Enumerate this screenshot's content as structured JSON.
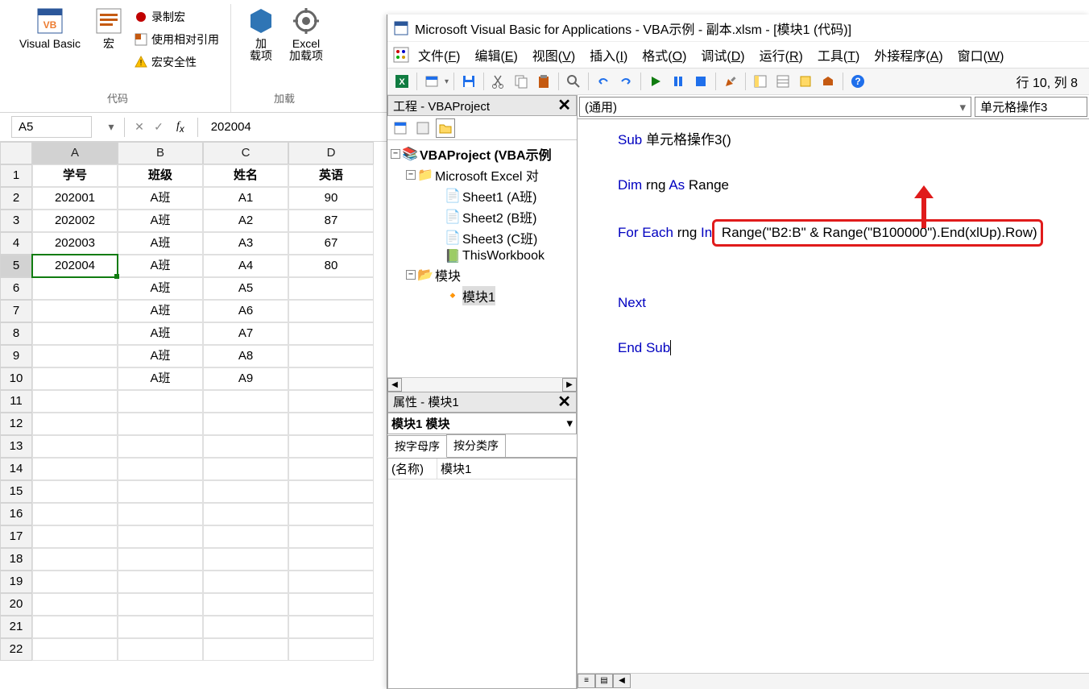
{
  "ribbon": {
    "vb_label": "Visual Basic",
    "macro_label": "宏",
    "record_macro": "录制宏",
    "use_relative": "使用相对引用",
    "macro_security": "宏安全性",
    "addins_label": "加\n载项",
    "excel_addins": "Excel\n加载项",
    "group_code": "代码",
    "group_addins": "加载"
  },
  "name_box": "A5",
  "formula_value": "202004",
  "columns": [
    "A",
    "B",
    "C",
    "D"
  ],
  "headers": [
    "学号",
    "班级",
    "姓名",
    "英语"
  ],
  "rows": [
    [
      "202001",
      "A班",
      "A1",
      "90"
    ],
    [
      "202002",
      "A班",
      "A2",
      "87"
    ],
    [
      "202003",
      "A班",
      "A3",
      "67"
    ],
    [
      "202004",
      "A班",
      "A4",
      "80"
    ],
    [
      "",
      "A班",
      "A5",
      ""
    ],
    [
      "",
      "A班",
      "A6",
      ""
    ],
    [
      "",
      "A班",
      "A7",
      ""
    ],
    [
      "",
      "A班",
      "A8",
      ""
    ],
    [
      "",
      "A班",
      "A9",
      ""
    ]
  ],
  "vba": {
    "title": "Microsoft Visual Basic for Applications - VBA示例 - 副本.xlsm - [模块1 (代码)]",
    "menu": [
      "文件(F)",
      "编辑(E)",
      "视图(V)",
      "插入(I)",
      "格式(O)",
      "调试(D)",
      "运行(R)",
      "工具(T)",
      "外接程序(A)",
      "窗口(W)"
    ],
    "status": "行 10, 列 8",
    "project_pane_title": "工程 - VBAProject",
    "tree": {
      "root": "VBAProject (VBA示例",
      "excel_objs": "Microsoft Excel 对",
      "sheet1": "Sheet1 (A班)",
      "sheet2": "Sheet2 (B班)",
      "sheet3": "Sheet3 (C班)",
      "workbook": "ThisWorkbook",
      "modules_folder": "模块",
      "module1": "模块1"
    },
    "props_title": "属性 - 模块1",
    "props_name_sel": "模块1 模块",
    "props_tabs": [
      "按字母序",
      "按分类序"
    ],
    "props_row_key": "(名称)",
    "props_row_val": "模块1",
    "code_sel_left": "(通用)",
    "code_sel_right": "单元格操作3",
    "code": {
      "l1_sub": "Sub",
      "l1_rest": " 单元格操作3()",
      "l2_dim": "Dim",
      "l2_rest1": " rng ",
      "l2_as": "As",
      "l2_rest2": " Range",
      "l3_for": "For Each",
      "l3_rest1": " rng ",
      "l3_in": "In",
      "l3_box": " Range(\"B2:B\" & Range(\"B100000\").End(xlUp).Row)",
      "l4_next": "Next",
      "l5_end": "End Sub"
    }
  }
}
